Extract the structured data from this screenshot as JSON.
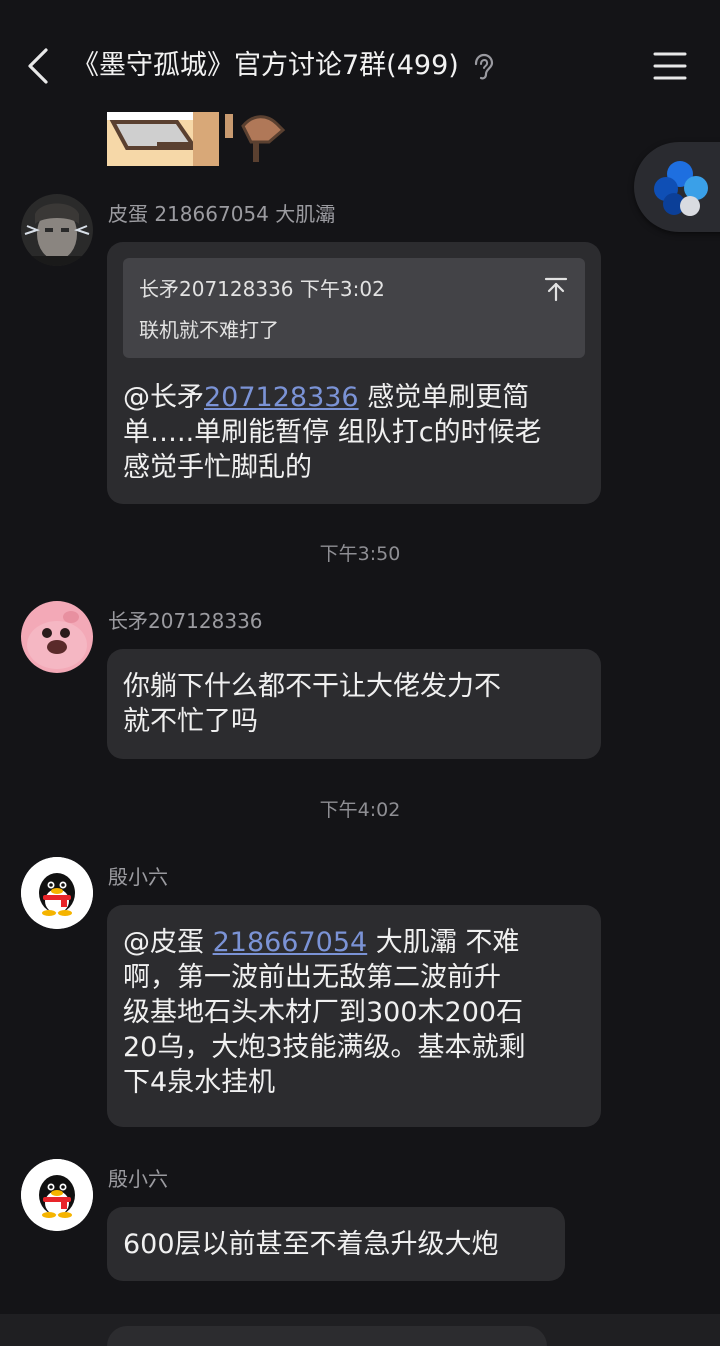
{
  "header": {
    "title": "《墨守孤城》官方讨论7群(499)",
    "back_icon": "chevron-left-icon",
    "mode_icon": "ear-icon",
    "menu_icon": "hamburger-menu-icon"
  },
  "floating_button": {
    "icon": "qq-assistant-icon"
  },
  "messages": [
    {
      "sender": "皮蛋 218667054 大肌灞",
      "quote": {
        "header": "长矛207128336 下午3:02",
        "text": "联机就不难打了",
        "jump_icon": "jump-to-top-icon"
      },
      "mention_prefix": "@长矛",
      "mention_number": "207128336",
      "text": " 感觉单刷更简\n单…..单刷能暂停 组队打c的时候老\n感觉手忙脚乱的"
    },
    {
      "sender": "长矛207128336",
      "text": "你躺下什么都不干让大佬发力不\n就不忙了吗"
    },
    {
      "sender": "殷小六",
      "mention_prefix": "@皮蛋 ",
      "mention_number": "218667054",
      "text": " 大肌灞 不难\n啊，第一波前出无敌第二波前升\n级基地石头木材厂到300木200石\n20乌，大炮3技能满级。基本就剩\n下4泉水挂机"
    },
    {
      "sender": "殷小六",
      "text": "600层以前甚至不着急升级大炮"
    }
  ],
  "time_separators": [
    "下午3:50",
    "下午4:02"
  ],
  "colors": {
    "background": "#141417",
    "bubble": "#2c2c2f",
    "quote_box": "#434347",
    "mention": "#7b93d6",
    "muted_text": "#9b9ba0"
  }
}
